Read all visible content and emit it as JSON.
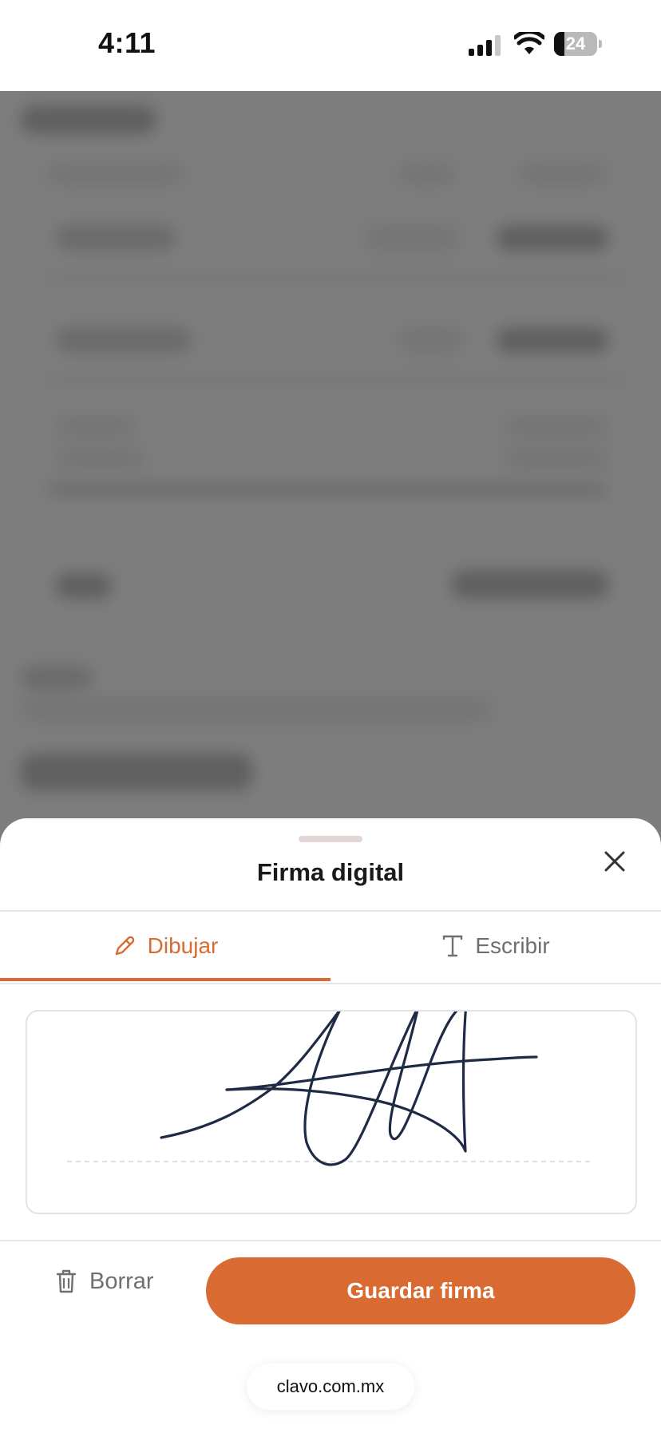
{
  "status_bar": {
    "time": "4:11",
    "battery_level": "24",
    "icons": [
      "cellular-signal-icon",
      "wifi-icon",
      "battery-icon"
    ]
  },
  "sheet": {
    "title": "Firma digital",
    "close_icon": "close-icon",
    "tabs": [
      {
        "label": "Dibujar",
        "icon": "pencil-icon",
        "active": true
      },
      {
        "label": "Escribir",
        "icon": "text-icon",
        "active": false
      }
    ],
    "clear_label": "Borrar",
    "clear_icon": "trash-icon",
    "save_label": "Guardar firma"
  },
  "browser": {
    "url": "clavo.com.mx"
  },
  "colors": {
    "accent": "#d96a31",
    "ink": "#1f2a44",
    "backdrop": "#7c7d7c"
  }
}
